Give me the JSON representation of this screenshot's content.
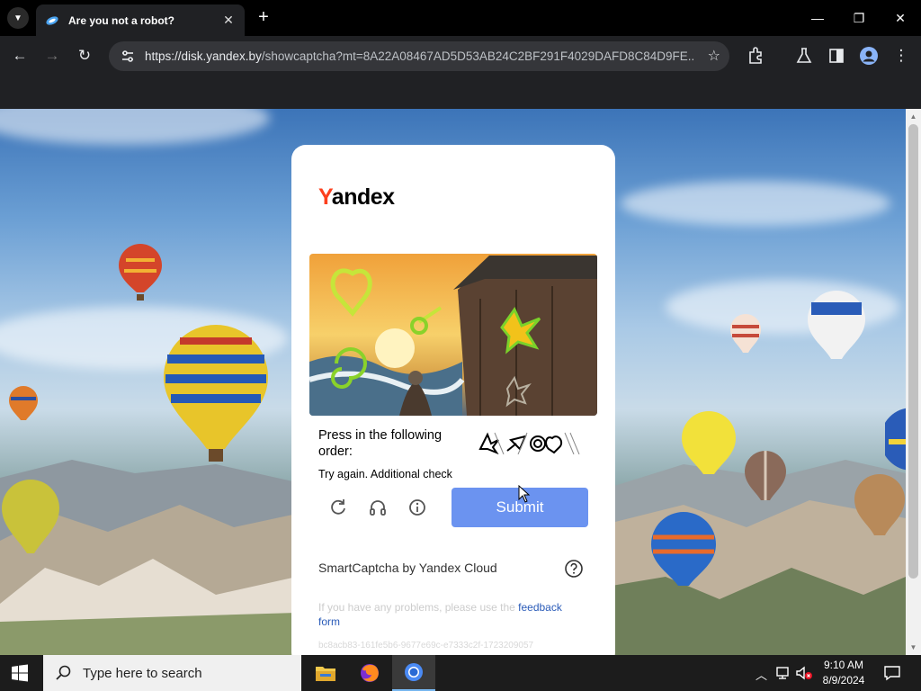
{
  "browser": {
    "tab_title": "Are you not a robot?",
    "tab_close": "✕",
    "new_tab": "+",
    "url_host": "https://disk.yandex.by",
    "url_path": "/showcaptcha?mt=8A22A08467AD5D53AB24C2BF291F4029DAFD8C84D9FE...",
    "window": {
      "minimize": "—",
      "restore": "❐",
      "close": "✕"
    }
  },
  "captcha": {
    "logo_first": "Y",
    "logo_rest": "andex",
    "prompt": "Press in the following order:",
    "error": "Try again. Additional check",
    "submit_label": "Submit",
    "brand": "SmartCaptcha by Yandex Cloud",
    "problems_text": "If you have any problems, please use the ",
    "problems_link": "feedback form",
    "token": "bc8acb83-161fe5b6-9677e69c-e7333c2f-1723209057"
  },
  "taskbar": {
    "search_placeholder": "Type here to search",
    "time": "9:10 AM",
    "date": "8/9/2024"
  },
  "colors": {
    "submit": "#6b93f0",
    "yandex_red": "#fc3f1d",
    "chrome_dark": "#202124"
  }
}
